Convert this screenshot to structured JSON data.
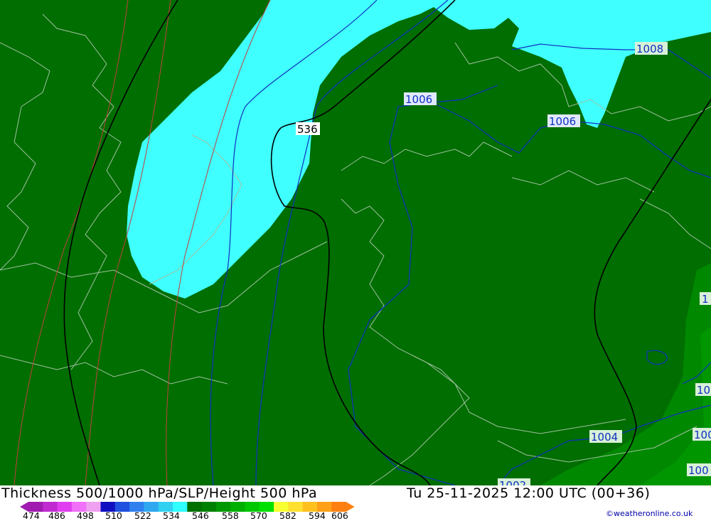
{
  "header": {
    "title": "Thickness 500/1000 hPa/SLP/Height 500 hPa",
    "valid_time": "Tu 25-11-2025 12:00 UTC (00+36)",
    "credit": "©weatheronline.co.uk"
  },
  "legend": {
    "ticks": [
      "474",
      "486",
      "498",
      "510",
      "522",
      "534",
      "546",
      "558",
      "570",
      "582",
      "594",
      "606"
    ],
    "colors": [
      "#a01cb0",
      "#c02bd0",
      "#e040f0",
      "#f070f8",
      "#f0a0f0",
      "#1010c0",
      "#2050e0",
      "#3080f0",
      "#30a8f0",
      "#30d0f0",
      "#30ffff",
      "#007000",
      "#008000",
      "#009800",
      "#00b000",
      "#00c800",
      "#00e000",
      "#f8ff30",
      "#ffe030",
      "#ffc020",
      "#ffa018",
      "#ff8010"
    ]
  },
  "map": {
    "fill_colors": {
      "cyan": "#40ffff",
      "dark_green": "#006e00",
      "green": "#008800",
      "light_green": "#00a800"
    },
    "labels": {
      "h536": "536",
      "p1006_a": "1006",
      "p1006_b": "1006",
      "p1008": "1008",
      "p1004": "1004",
      "p1002": "1002",
      "edge1": "1",
      "edge2": "10",
      "edge3": "100",
      "edge4": "100"
    }
  }
}
